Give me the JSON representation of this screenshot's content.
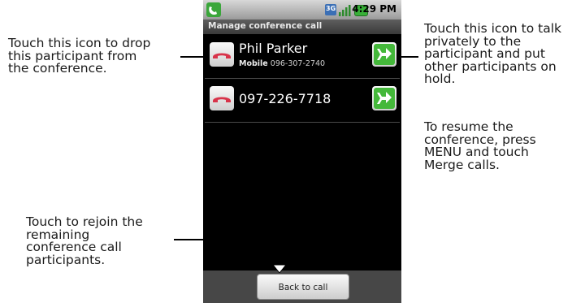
{
  "callouts": {
    "drop": [
      "Touch this icon to drop",
      "this participant from",
      "the conference."
    ],
    "private": [
      "Touch this icon to talk",
      "privately to the",
      "participant and put",
      "other participants on",
      "hold."
    ],
    "resume": [
      "To resume the",
      "conference, press",
      "MENU and touch",
      "Merge calls."
    ],
    "rejoin": [
      "Touch to rejoin the",
      "remaining",
      "conference call",
      "participants."
    ]
  },
  "status_bar": {
    "time": "4:29 PM",
    "network": "3G"
  },
  "title_bar": {
    "title": "Manage conference call"
  },
  "participants": [
    {
      "name": "Phil Parker",
      "label": "Mobile",
      "number": "096-307-2740"
    },
    {
      "name": "097-226-7718"
    }
  ],
  "bottom": {
    "back_label": "Back to call"
  },
  "colors": {
    "drop_icon": "#d8334a",
    "private_icon": "#44b83a",
    "background": "#000000"
  }
}
